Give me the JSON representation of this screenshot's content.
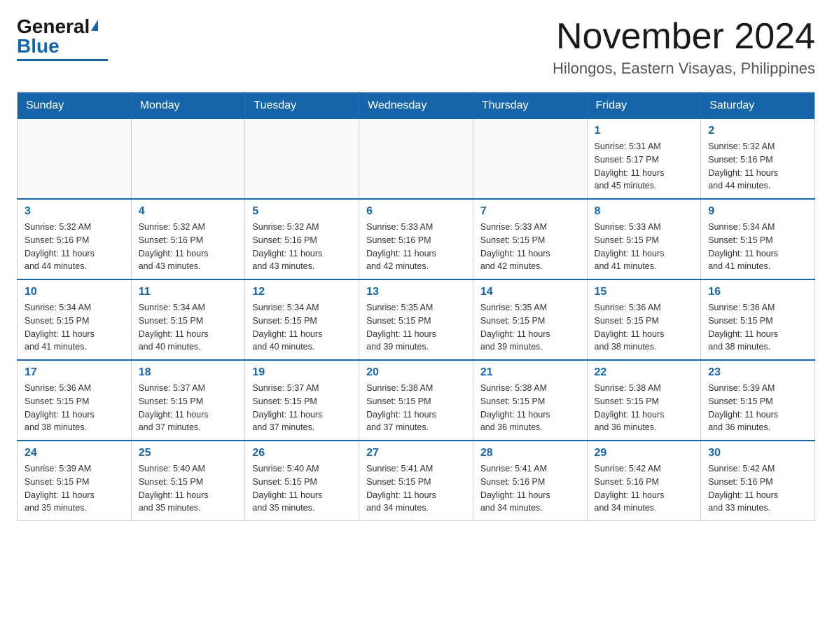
{
  "header": {
    "logo_general": "General",
    "logo_blue": "Blue",
    "month_title": "November 2024",
    "location": "Hilongos, Eastern Visayas, Philippines"
  },
  "weekdays": [
    "Sunday",
    "Monday",
    "Tuesday",
    "Wednesday",
    "Thursday",
    "Friday",
    "Saturday"
  ],
  "weeks": [
    [
      {
        "day": "",
        "info": ""
      },
      {
        "day": "",
        "info": ""
      },
      {
        "day": "",
        "info": ""
      },
      {
        "day": "",
        "info": ""
      },
      {
        "day": "",
        "info": ""
      },
      {
        "day": "1",
        "info": "Sunrise: 5:31 AM\nSunset: 5:17 PM\nDaylight: 11 hours\nand 45 minutes."
      },
      {
        "day": "2",
        "info": "Sunrise: 5:32 AM\nSunset: 5:16 PM\nDaylight: 11 hours\nand 44 minutes."
      }
    ],
    [
      {
        "day": "3",
        "info": "Sunrise: 5:32 AM\nSunset: 5:16 PM\nDaylight: 11 hours\nand 44 minutes."
      },
      {
        "day": "4",
        "info": "Sunrise: 5:32 AM\nSunset: 5:16 PM\nDaylight: 11 hours\nand 43 minutes."
      },
      {
        "day": "5",
        "info": "Sunrise: 5:32 AM\nSunset: 5:16 PM\nDaylight: 11 hours\nand 43 minutes."
      },
      {
        "day": "6",
        "info": "Sunrise: 5:33 AM\nSunset: 5:16 PM\nDaylight: 11 hours\nand 42 minutes."
      },
      {
        "day": "7",
        "info": "Sunrise: 5:33 AM\nSunset: 5:15 PM\nDaylight: 11 hours\nand 42 minutes."
      },
      {
        "day": "8",
        "info": "Sunrise: 5:33 AM\nSunset: 5:15 PM\nDaylight: 11 hours\nand 41 minutes."
      },
      {
        "day": "9",
        "info": "Sunrise: 5:34 AM\nSunset: 5:15 PM\nDaylight: 11 hours\nand 41 minutes."
      }
    ],
    [
      {
        "day": "10",
        "info": "Sunrise: 5:34 AM\nSunset: 5:15 PM\nDaylight: 11 hours\nand 41 minutes."
      },
      {
        "day": "11",
        "info": "Sunrise: 5:34 AM\nSunset: 5:15 PM\nDaylight: 11 hours\nand 40 minutes."
      },
      {
        "day": "12",
        "info": "Sunrise: 5:34 AM\nSunset: 5:15 PM\nDaylight: 11 hours\nand 40 minutes."
      },
      {
        "day": "13",
        "info": "Sunrise: 5:35 AM\nSunset: 5:15 PM\nDaylight: 11 hours\nand 39 minutes."
      },
      {
        "day": "14",
        "info": "Sunrise: 5:35 AM\nSunset: 5:15 PM\nDaylight: 11 hours\nand 39 minutes."
      },
      {
        "day": "15",
        "info": "Sunrise: 5:36 AM\nSunset: 5:15 PM\nDaylight: 11 hours\nand 38 minutes."
      },
      {
        "day": "16",
        "info": "Sunrise: 5:36 AM\nSunset: 5:15 PM\nDaylight: 11 hours\nand 38 minutes."
      }
    ],
    [
      {
        "day": "17",
        "info": "Sunrise: 5:36 AM\nSunset: 5:15 PM\nDaylight: 11 hours\nand 38 minutes."
      },
      {
        "day": "18",
        "info": "Sunrise: 5:37 AM\nSunset: 5:15 PM\nDaylight: 11 hours\nand 37 minutes."
      },
      {
        "day": "19",
        "info": "Sunrise: 5:37 AM\nSunset: 5:15 PM\nDaylight: 11 hours\nand 37 minutes."
      },
      {
        "day": "20",
        "info": "Sunrise: 5:38 AM\nSunset: 5:15 PM\nDaylight: 11 hours\nand 37 minutes."
      },
      {
        "day": "21",
        "info": "Sunrise: 5:38 AM\nSunset: 5:15 PM\nDaylight: 11 hours\nand 36 minutes."
      },
      {
        "day": "22",
        "info": "Sunrise: 5:38 AM\nSunset: 5:15 PM\nDaylight: 11 hours\nand 36 minutes."
      },
      {
        "day": "23",
        "info": "Sunrise: 5:39 AM\nSunset: 5:15 PM\nDaylight: 11 hours\nand 36 minutes."
      }
    ],
    [
      {
        "day": "24",
        "info": "Sunrise: 5:39 AM\nSunset: 5:15 PM\nDaylight: 11 hours\nand 35 minutes."
      },
      {
        "day": "25",
        "info": "Sunrise: 5:40 AM\nSunset: 5:15 PM\nDaylight: 11 hours\nand 35 minutes."
      },
      {
        "day": "26",
        "info": "Sunrise: 5:40 AM\nSunset: 5:15 PM\nDaylight: 11 hours\nand 35 minutes."
      },
      {
        "day": "27",
        "info": "Sunrise: 5:41 AM\nSunset: 5:15 PM\nDaylight: 11 hours\nand 34 minutes."
      },
      {
        "day": "28",
        "info": "Sunrise: 5:41 AM\nSunset: 5:16 PM\nDaylight: 11 hours\nand 34 minutes."
      },
      {
        "day": "29",
        "info": "Sunrise: 5:42 AM\nSunset: 5:16 PM\nDaylight: 11 hours\nand 34 minutes."
      },
      {
        "day": "30",
        "info": "Sunrise: 5:42 AM\nSunset: 5:16 PM\nDaylight: 11 hours\nand 33 minutes."
      }
    ]
  ]
}
